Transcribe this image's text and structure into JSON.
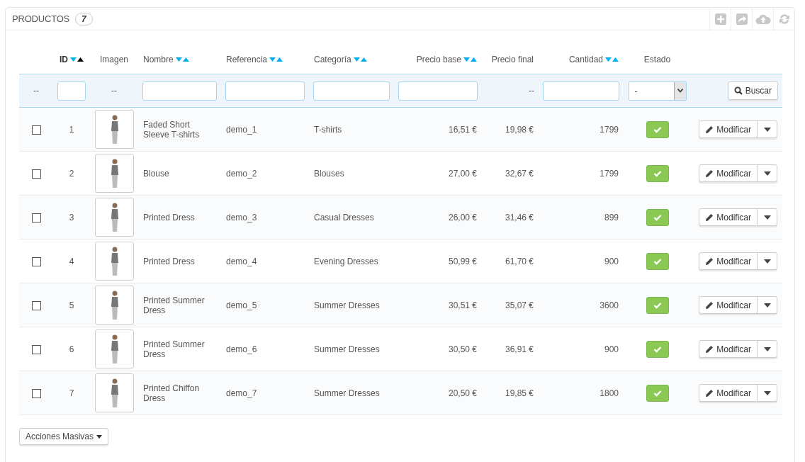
{
  "panel": {
    "title": "PRODUCTOS",
    "count": "7"
  },
  "columns": [
    {
      "label": "ID",
      "sortable": true,
      "sorted": true
    },
    {
      "label": "Imagen",
      "sortable": false,
      "sorted": false
    },
    {
      "label": "Nombre",
      "sortable": true,
      "sorted": false
    },
    {
      "label": "Referencia",
      "sortable": true,
      "sorted": false
    },
    {
      "label": "Categoría",
      "sortable": true,
      "sorted": false
    },
    {
      "label": "Precio base",
      "sortable": true,
      "sorted": false
    },
    {
      "label": "Precio final",
      "sortable": false,
      "sorted": false
    },
    {
      "label": "Cantidad",
      "sortable": true,
      "sorted": false
    },
    {
      "label": "Estado",
      "sortable": false,
      "sorted": false
    }
  ],
  "filters": [
    {
      "kind": "none",
      "text": "--"
    },
    {
      "kind": "input"
    },
    {
      "kind": "none",
      "text": "--"
    },
    {
      "kind": "input"
    },
    {
      "kind": "input"
    },
    {
      "kind": "input"
    },
    {
      "kind": "input"
    },
    {
      "kind": "none",
      "text": "--"
    },
    {
      "kind": "input"
    },
    {
      "kind": "select",
      "value": "-"
    },
    {
      "kind": "button",
      "text": "Buscar"
    }
  ],
  "rows": [
    {
      "checked": false,
      "id": "1",
      "name": "Faded Short Sleeve T-shirts",
      "reference": "demo_1",
      "category": "T-shirts",
      "base_price": "16,51 €",
      "final_price": "19,98 €",
      "quantity": "1799",
      "active": true,
      "action": "Modificar"
    },
    {
      "checked": false,
      "id": "2",
      "name": "Blouse",
      "reference": "demo_2",
      "category": "Blouses",
      "base_price": "27,00 €",
      "final_price": "32,67 €",
      "quantity": "1799",
      "active": true,
      "action": "Modificar"
    },
    {
      "checked": false,
      "id": "3",
      "name": "Printed Dress",
      "reference": "demo_3",
      "category": "Casual Dresses",
      "base_price": "26,00 €",
      "final_price": "31,46 €",
      "quantity": "899",
      "active": true,
      "action": "Modificar"
    },
    {
      "checked": false,
      "id": "4",
      "name": "Printed Dress",
      "reference": "demo_4",
      "category": "Evening Dresses",
      "base_price": "50,99 €",
      "final_price": "61,70 €",
      "quantity": "900",
      "active": true,
      "action": "Modificar"
    },
    {
      "checked": false,
      "id": "5",
      "name": "Printed Summer Dress",
      "reference": "demo_5",
      "category": "Summer Dresses",
      "base_price": "30,51 €",
      "final_price": "35,07 €",
      "quantity": "3600",
      "active": true,
      "action": "Modificar"
    },
    {
      "checked": false,
      "id": "6",
      "name": "Printed Summer Dress",
      "reference": "demo_6",
      "category": "Summer Dresses",
      "base_price": "30,50 €",
      "final_price": "36,91 €",
      "quantity": "900",
      "active": true,
      "action": "Modificar"
    },
    {
      "checked": false,
      "id": "7",
      "name": "Printed Chiffon Dress",
      "reference": "demo_7",
      "category": "Summer Dresses",
      "base_price": "20,50 €",
      "final_price": "19,85 €",
      "quantity": "1800",
      "active": true,
      "action": "Modificar"
    }
  ],
  "bulk_button": "Acciones Masivas"
}
